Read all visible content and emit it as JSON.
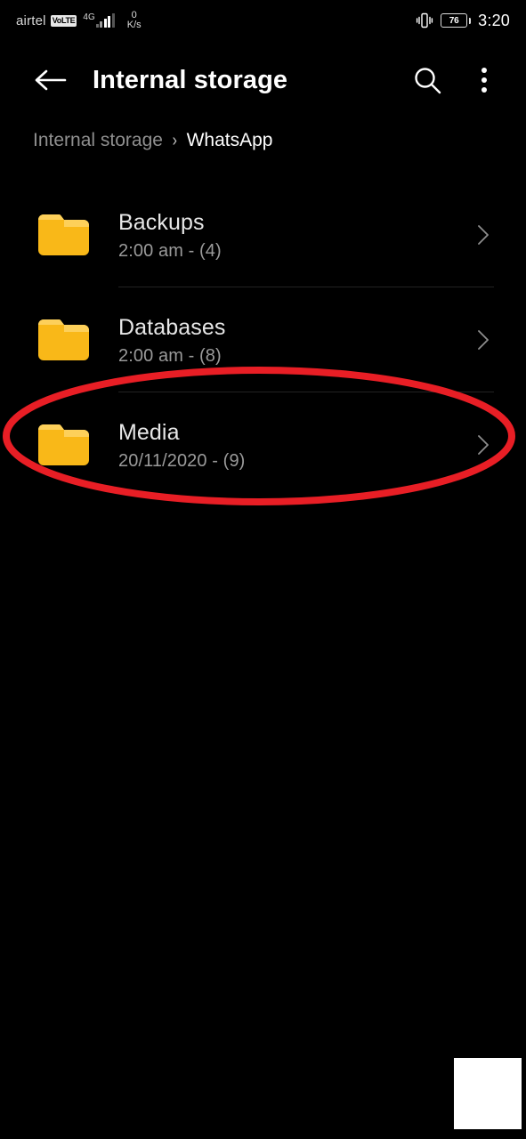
{
  "status_bar": {
    "carrier": "airtel",
    "volte_badge": "VoLTE",
    "network_type": "4G",
    "data_rate_value": "0",
    "data_rate_unit": "K/s",
    "vibrate_icon": "vibrate-icon",
    "battery_percent": "76",
    "clock": "3:20"
  },
  "app_bar": {
    "back_icon": "back-arrow-icon",
    "title": "Internal storage",
    "search_icon": "search-icon",
    "overflow_icon": "more-vertical-icon"
  },
  "breadcrumb": {
    "root": "Internal storage",
    "separator": "›",
    "current": "WhatsApp"
  },
  "file_list": {
    "items": [
      {
        "name": "Backups",
        "meta": "2:00 am - (4)",
        "icon": "folder-icon",
        "chevron": "chevron-right-icon",
        "highlighted": false
      },
      {
        "name": "Databases",
        "meta": "2:00 am - (8)",
        "icon": "folder-icon",
        "chevron": "chevron-right-icon",
        "highlighted": false
      },
      {
        "name": "Media",
        "meta": "20/11/2020 - (9)",
        "icon": "folder-icon",
        "chevron": "chevron-right-icon",
        "highlighted": true
      }
    ]
  },
  "annotation": {
    "shape": "ellipse-highlight",
    "color": "#e81e25",
    "target": "Media"
  },
  "colors": {
    "background": "#000000",
    "folder": "#f9b818",
    "folder_tab": "#fdd05a",
    "title_text": "#e6e6e6",
    "meta_text": "#9a9a9a",
    "breadcrumb_muted": "#8f8f8f",
    "divider": "#232323",
    "annotation_red": "#e81e25"
  }
}
